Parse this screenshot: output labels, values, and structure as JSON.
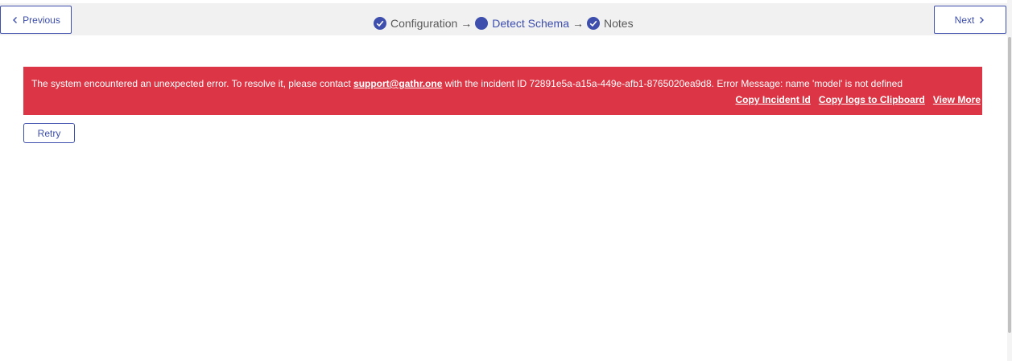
{
  "nav": {
    "previous_label": "Previous",
    "next_label": "Next"
  },
  "steps": [
    {
      "label": "Configuration",
      "status": "complete",
      "icon": "check-circle-icon"
    },
    {
      "label": "Detect Schema",
      "status": "active",
      "icon": "filled-circle-icon"
    },
    {
      "label": "Notes",
      "status": "complete",
      "icon": "check-circle-icon"
    }
  ],
  "step_arrow": "→",
  "error": {
    "message_prefix": "The system encountered an unexpected error. To resolve it, please contact ",
    "support_email": "support@gathr.one",
    "message_suffix": " with the incident ID 72891e5a-a15a-449e-afb1-8765020ea9d8. Error Message: name 'model' is not defined",
    "actions": {
      "copy_incident": "Copy Incident Id",
      "copy_logs": "Copy logs to Clipboard",
      "view_more": "View More"
    }
  },
  "retry_label": "Retry",
  "colors": {
    "primary": "#3d4eac",
    "error_bg": "#dc3545",
    "topbar_bg": "#f1f1f1"
  }
}
